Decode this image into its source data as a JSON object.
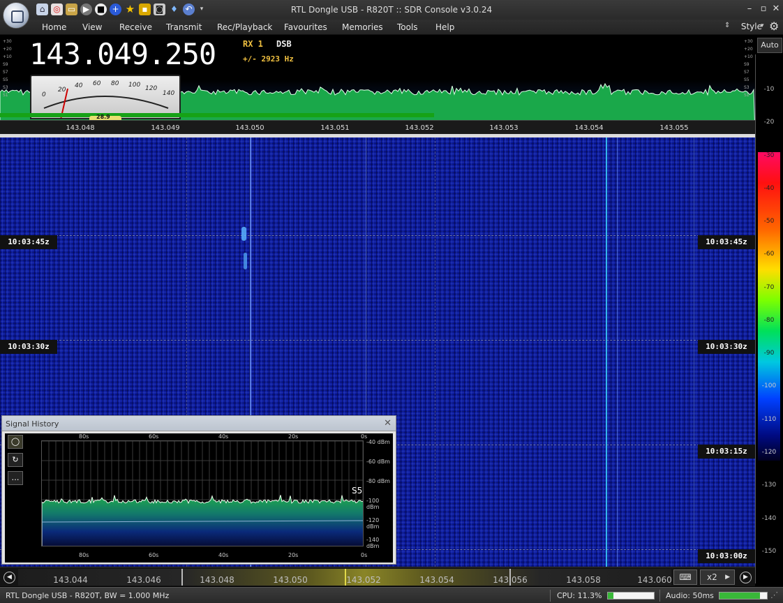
{
  "window": {
    "title": "RTL Dongle USB - R820T :: SDR Console v3.0.24",
    "controls": [
      "minimize-icon",
      "restore-icon",
      "close-icon"
    ]
  },
  "quick_access": [
    "home-icon",
    "lifebuoy-icon",
    "folder-icon",
    "play-icon",
    "stop-icon",
    "add-icon",
    "favourite-star-icon",
    "lock-icon",
    "camera-icon",
    "drop-icon",
    "undo-icon",
    "dropdown-arrow-icon"
  ],
  "menu": [
    "Home",
    "View",
    "Receive",
    "Transmit",
    "Rec/Playback",
    "Favourites",
    "Memories",
    "Tools",
    "Help"
  ],
  "style_label": "Style",
  "receiver": {
    "frequency": "143.049.250",
    "rx": "RX 1",
    "mode": "DSB",
    "offset": "+/- 2923 Hz",
    "meter_scale": [
      "0",
      "20",
      "40",
      "60",
      "80",
      "100",
      "120",
      "140"
    ],
    "meter_value": "28.9"
  },
  "spectrum": {
    "s_scale": [
      "+30",
      "+20",
      "+10",
      "S9",
      "S7",
      "S5",
      "S3",
      "S1"
    ],
    "ruler": [
      "143.048",
      "143.049",
      "143.050",
      "143.051",
      "143.052",
      "143.053",
      "143.054",
      "143.055"
    ]
  },
  "right_scale": {
    "auto": "Auto",
    "upper": [
      "-10",
      "-20"
    ],
    "colorbar": [
      "-30",
      "-40",
      "-50",
      "-60",
      "-70",
      "-80",
      "-90",
      "-100",
      "-110",
      "-120"
    ],
    "lower": [
      "-130",
      "-140",
      "-150"
    ]
  },
  "waterfall": {
    "time_labels": [
      "10:03:45z",
      "10:03:30z",
      "10:03:15z",
      "10:03:00z"
    ]
  },
  "signal_history": {
    "title": "Signal History",
    "buttons": [
      "circle-icon",
      "refresh-icon",
      "more-icon"
    ],
    "time_axis": [
      "80s",
      "60s",
      "40s",
      "20s",
      "0s"
    ],
    "dbm_axis": [
      "-40 dBm",
      "-60 dBm",
      "-80 dBm",
      "-100 dBm",
      "-120 dBm",
      "-140 dBm"
    ],
    "s_label": "S5"
  },
  "bottom_bar": {
    "freqs": [
      "143.044",
      "143.046",
      "143.048",
      "143.050",
      "143.052",
      "143.054",
      "143.056",
      "143.058",
      "143.060"
    ],
    "zoom": "x2"
  },
  "status": {
    "left": "RTL Dongle USB - R820T, BW = 1.000 MHz",
    "cpu": "CPU: 11.3%",
    "cpu_level": 0.12,
    "audio": "Audio: 50ms",
    "audio_level": 0.85
  },
  "colors": {
    "spectrum_fill": "#1aa84a",
    "waterfall_bg": "#0c1a9a",
    "accent": "#f0c040"
  }
}
